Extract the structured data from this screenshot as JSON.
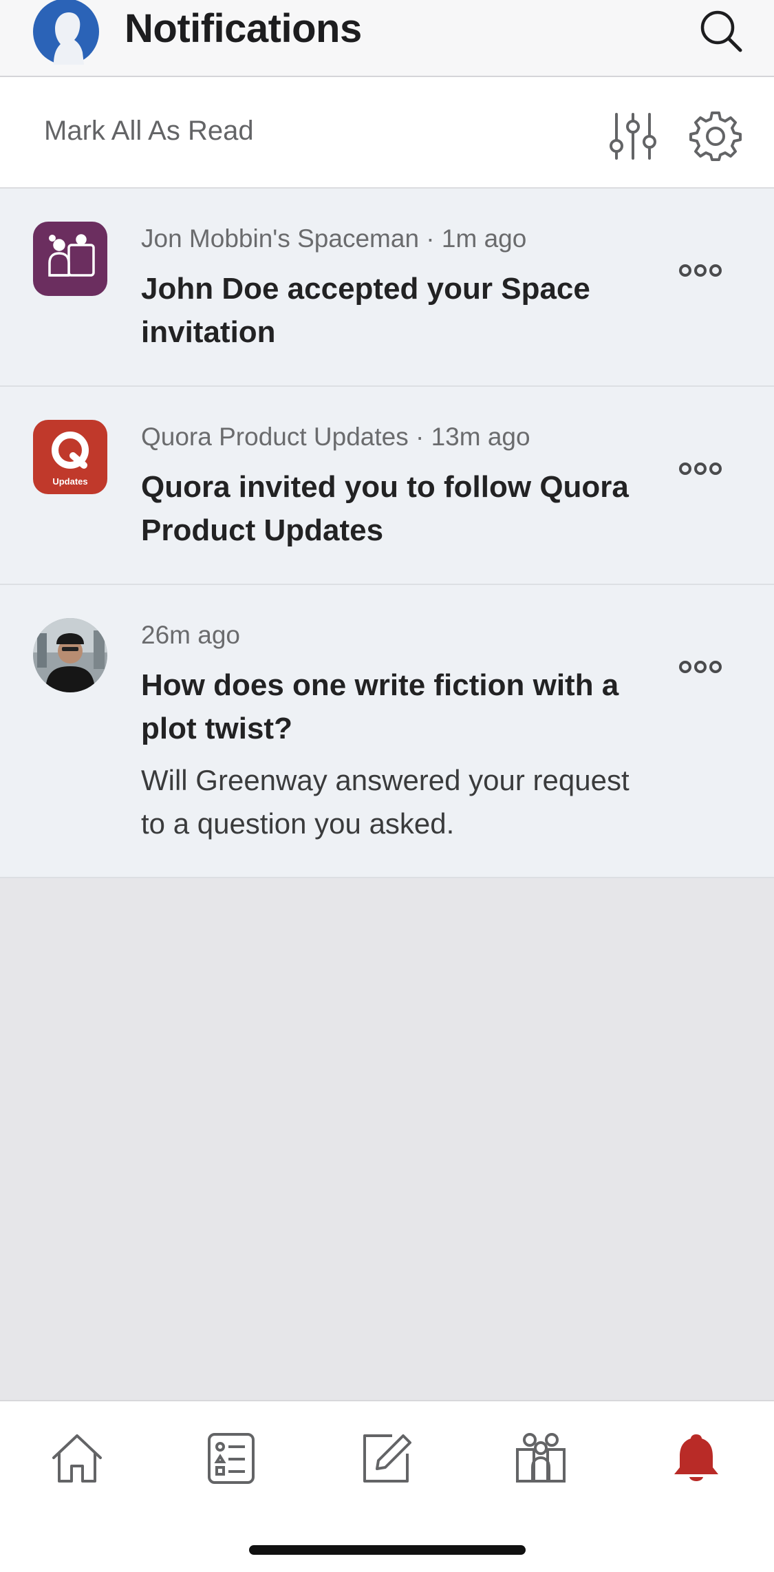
{
  "header": {
    "title": "Notifications",
    "profile_icon": "profile-silhouette-icon",
    "search_icon": "search-icon"
  },
  "subbar": {
    "mark_all_label": "Mark All As Read",
    "filter_icon": "filter-sliders-icon",
    "settings_icon": "gear-icon"
  },
  "notifications": [
    {
      "icon": "space-icon",
      "meta": "Jon Mobbin's Spaceman · 1m ago",
      "headline": "John Doe accepted your Space invitation",
      "body": ""
    },
    {
      "icon": "quora-updates-icon",
      "icon_caption": "Updates",
      "meta": "Quora Product Updates · 13m ago",
      "headline": "Quora invited you to follow Quora Product Updates",
      "body": ""
    },
    {
      "icon": "user-avatar",
      "meta": "26m ago",
      "headline": "How does one write fiction with a plot twist?",
      "body": "Will Greenway answered your request to a question you asked."
    }
  ],
  "tabbar": {
    "items": [
      "home-icon",
      "answer-list-icon",
      "edit-icon",
      "spaces-icon",
      "bell-icon"
    ],
    "active": "bell-icon"
  },
  "colors": {
    "brand_red": "#b92b27",
    "profile_blue": "#2b63b7",
    "space_purple": "#6b2e5f",
    "unread_bg": "#eef1f5"
  }
}
